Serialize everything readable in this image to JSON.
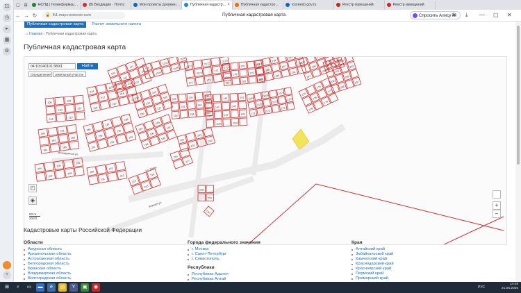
{
  "browser": {
    "tabs": [
      {
        "label": "НСПД | Геоинформац…",
        "color": "#2e7d32",
        "active": false
      },
      {
        "label": "(8) Входящие · Почта",
        "color": "#d32f2f",
        "active": false
      },
      {
        "label": "Мои проекты докумен…",
        "color": "#1565c0",
        "active": false
      },
      {
        "label": "Публичная кадастр…",
        "color": "#1e88e5",
        "active": true
      },
      {
        "label": "Публичная кадастро…",
        "color": "#ef6c00",
        "active": false
      },
      {
        "label": "rosreestr.gov.ru",
        "color": "#1565c0",
        "active": false
      },
      {
        "label": "Реестр извещений",
        "color": "#c62828",
        "active": false
      },
      {
        "label": "Реестр извещений",
        "color": "#c62828",
        "active": false
      }
    ],
    "url": "lk1.map.rosreestr.com",
    "page_title": "Публичная кадастровая карта",
    "alice_label": "Спросить Алису AI",
    "tab_counter": "11"
  },
  "page": {
    "top_tab_primary": "Публичная кадастровая карта",
    "top_tab_secondary": "Расчет земельного налога",
    "breadcrumb_home": "Главная",
    "breadcrumb_current": "Публичная кадастровая карта",
    "title": "Публичная кадастровая карта"
  },
  "map": {
    "search_value": "04:10:040101:389/1",
    "find_button": "Найти",
    "select_mode": "Определение",
    "select_layer": "земельный участок",
    "zoom_in": "+",
    "zoom_out": "−",
    "scale_top": "50 m",
    "scale_bottom": "200 ft",
    "street_labels": [
      "ул. Мира",
      "Южная ул.",
      "Молодежная ул."
    ],
    "parcel_labels": [
      "140",
      "141",
      "142",
      "143",
      "145",
      "137",
      "139",
      "1101",
      "1102",
      "1104",
      "1105",
      "2171",
      "2172",
      "2173",
      "2174",
      "171",
      "172",
      "173",
      "174",
      "175",
      "176",
      "177",
      "178",
      "179",
      "180",
      "181",
      "182",
      "183",
      "184",
      "185",
      "186",
      "187",
      "188",
      "189",
      "190",
      "191",
      "192",
      "193",
      "194",
      "195",
      "196",
      "197",
      "198",
      "199",
      "200",
      "201",
      "202",
      "203",
      "204",
      "205",
      "206",
      "207",
      "208",
      "209",
      "210",
      "211",
      "212",
      "213",
      "214",
      "215",
      "216",
      "217",
      "218",
      "219",
      "220",
      "221",
      "222",
      "223",
      "224",
      "225",
      "226",
      "227",
      "228",
      "229",
      "230",
      "231",
      "232",
      "233",
      "234",
      "235",
      "236"
    ]
  },
  "regions": {
    "heading": "Кадастровые карты Российской Федерации",
    "col1_title": "Области",
    "col1_items": [
      "Амурская область",
      "Архангельская область",
      "Астраханская область",
      "Белгородская область",
      "Брянская область",
      "Владимирская область",
      "Волгоградская область"
    ],
    "col2_title": "Города федерального значения",
    "col2_items": [
      "г. Москва",
      "г. Санкт-Петербург",
      "г. Севастополь"
    ],
    "col2b_title": "Республики",
    "col2b_items": [
      "Республика Адыгея",
      "Республика Алтай"
    ],
    "col3_title": "Края",
    "col3_items": [
      "Алтайский край",
      "Забайкальский край",
      "Камчатский край",
      "Краснодарский край",
      "Красноярский край",
      "Пермский край",
      "Приморский край"
    ]
  },
  "taskbar": {
    "lang": "РУС",
    "time": "14:49",
    "date": "21.05.2026"
  },
  "colors": {
    "accent": "#1e6fb8",
    "parcel_stroke": "#d42a2a",
    "highlight": "#f2e35a"
  }
}
